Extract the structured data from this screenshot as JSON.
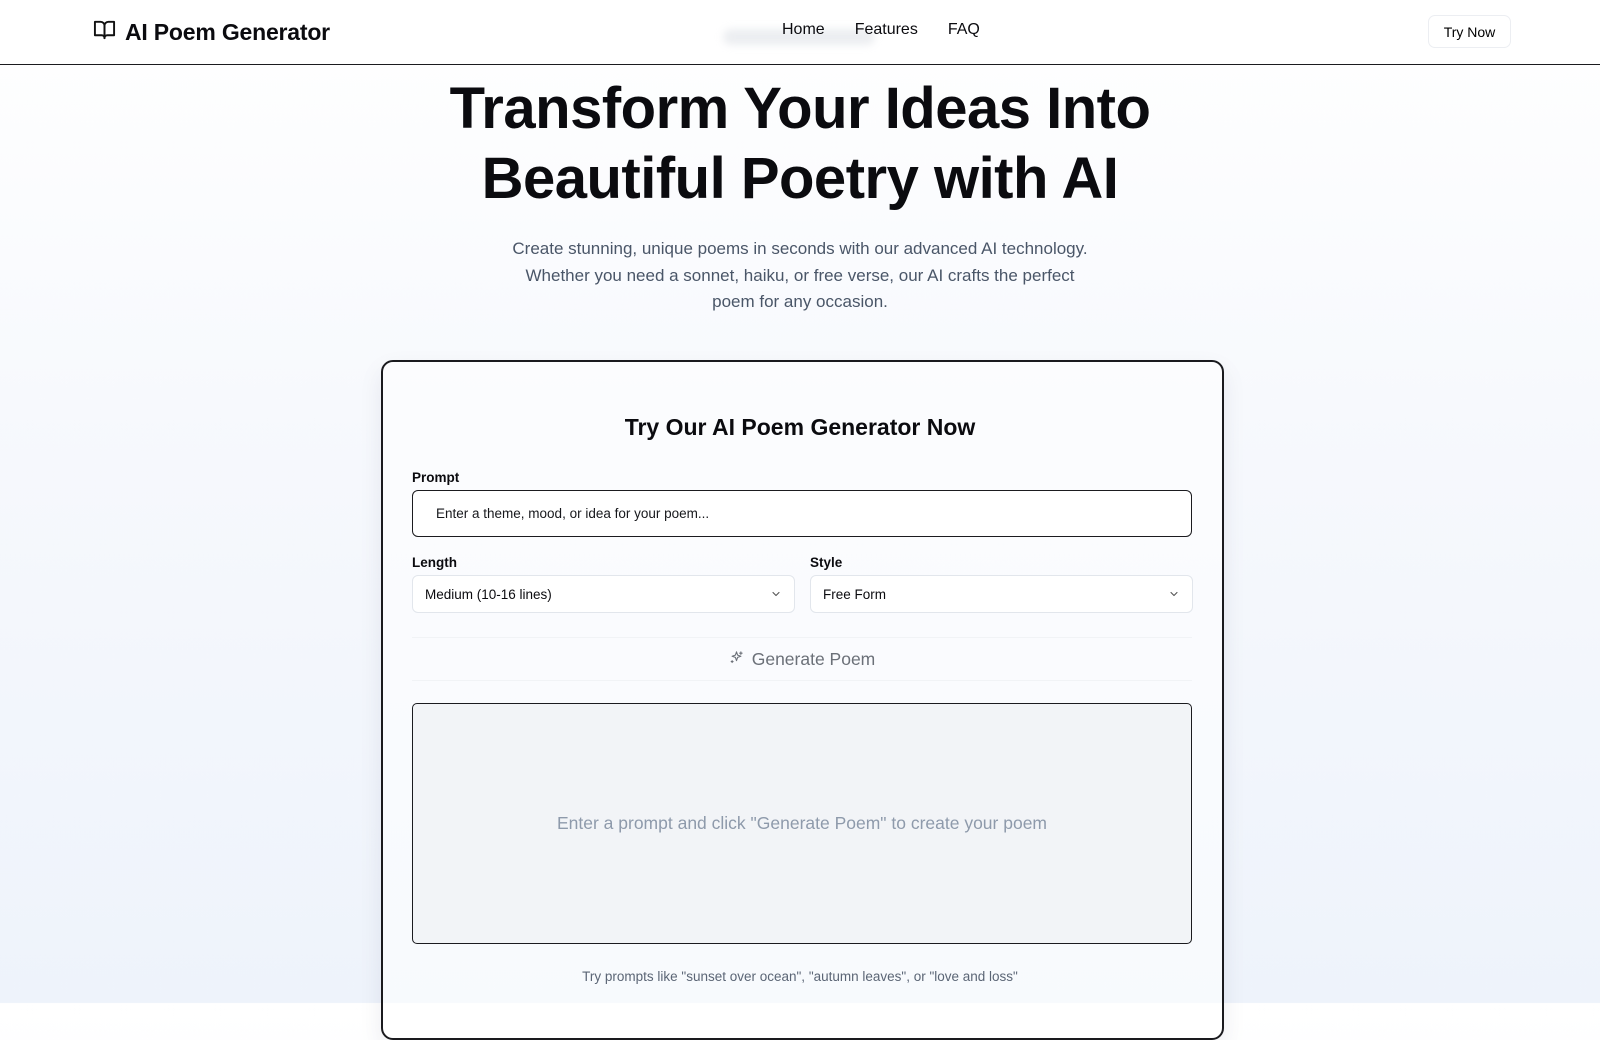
{
  "nav": {
    "brand": "AI Poem Generator",
    "brand_icon": "book-open-icon",
    "links": [
      "Home",
      "Features",
      "FAQ"
    ],
    "cta": "Try Now"
  },
  "hero": {
    "title_line1": "Transform Your Ideas Into",
    "title_line2": "Beautiful Poetry with AI",
    "subtitle_line1": "Create stunning, unique poems in seconds with our advanced AI technology.",
    "subtitle_line2": "Whether you need a sonnet, haiku, or free verse, our AI crafts the perfect",
    "subtitle_line3": "poem for any occasion."
  },
  "generator": {
    "title": "Try Our AI Poem Generator Now",
    "prompt_label": "Prompt",
    "prompt_placeholder": "Enter a theme, mood, or idea for your poem...",
    "prompt_value": "",
    "length_label": "Length",
    "length_value": "Medium (10-16 lines)",
    "style_label": "Style",
    "style_value": "Free Form",
    "generate_label": "Generate Poem",
    "generate_icon": "sparkles-icon",
    "output_placeholder": "Enter a prompt and click \"Generate Poem\" to create your poem",
    "hint": "Try prompts like \"sunset over ocean\", \"autumn leaves\", or \"love and loss\""
  },
  "colors": {
    "text": "#0b0b0f",
    "muted": "#4a5668",
    "output_bg": "#f2f4f7",
    "placeholder": "#8e9aab"
  }
}
